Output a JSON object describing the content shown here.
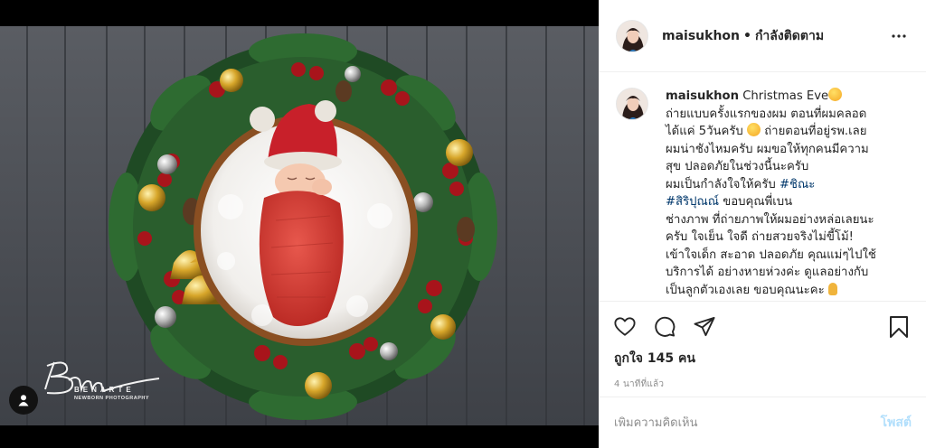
{
  "header": {
    "username": "maisukhon",
    "separator": "•",
    "follow_state": "กำลังติดตาม",
    "more_icon": "more-horizontal-icon"
  },
  "media": {
    "watermark_brand": "BENARTE",
    "watermark_sub": "NEWBORN PHOTOGRAPHY",
    "user_tag_icon": "person-icon"
  },
  "caption": {
    "username": "maisukhon",
    "first_text": "Christmas Eve",
    "lines": [
      "ถ่ายแบบครั้งแรกของผม ตอนที่ผมคลอด",
      "ได้แค่ 5วันครับ",
      " ถ่ายตอนที่อยู่รพ.เลย",
      "ผมน่าชังไหมครับ ผมขอให้ทุกคนมีความ",
      "สุข ปลอดภัยในช่วงนี้นะครับ",
      "ผมเป็นกำลังใจให้ครับ ",
      "#ชิณะ",
      "#สิริปุณณ์",
      " ขอบคุณพี่เบน",
      "ช่างภาพ ที่ถ่ายภาพให้ผมอย่างหล่อเลยนะ",
      "ครับ ใจเย็น ใจดี ถ่ายสวยจริงไม่ขี้โม้!",
      "เข้าใจเด็ก สะอาด ปลอดภัย คุณแม่ๆไปใช้",
      "บริการได้ อย่างหายห่วงค่ะ ดูแลอย่างกับ",
      "เป็นลูกตัวเองเลย ขอบคุณนะคะ"
    ]
  },
  "actions": {
    "like_icon": "heart-icon",
    "comment_icon": "comment-icon",
    "share_icon": "share-icon",
    "save_icon": "bookmark-icon",
    "likes_text": "ถูกใจ 145 คน",
    "timestamp": "4 นาทีที่แล้ว"
  },
  "comment_box": {
    "placeholder": "เพิ่มความคิดเห็น",
    "post_label": "โพสต์"
  },
  "colors": {
    "link": "#00376b",
    "post_button_disabled": "#b2dffc",
    "muted": "#8e8e8e",
    "border": "#efefef"
  }
}
